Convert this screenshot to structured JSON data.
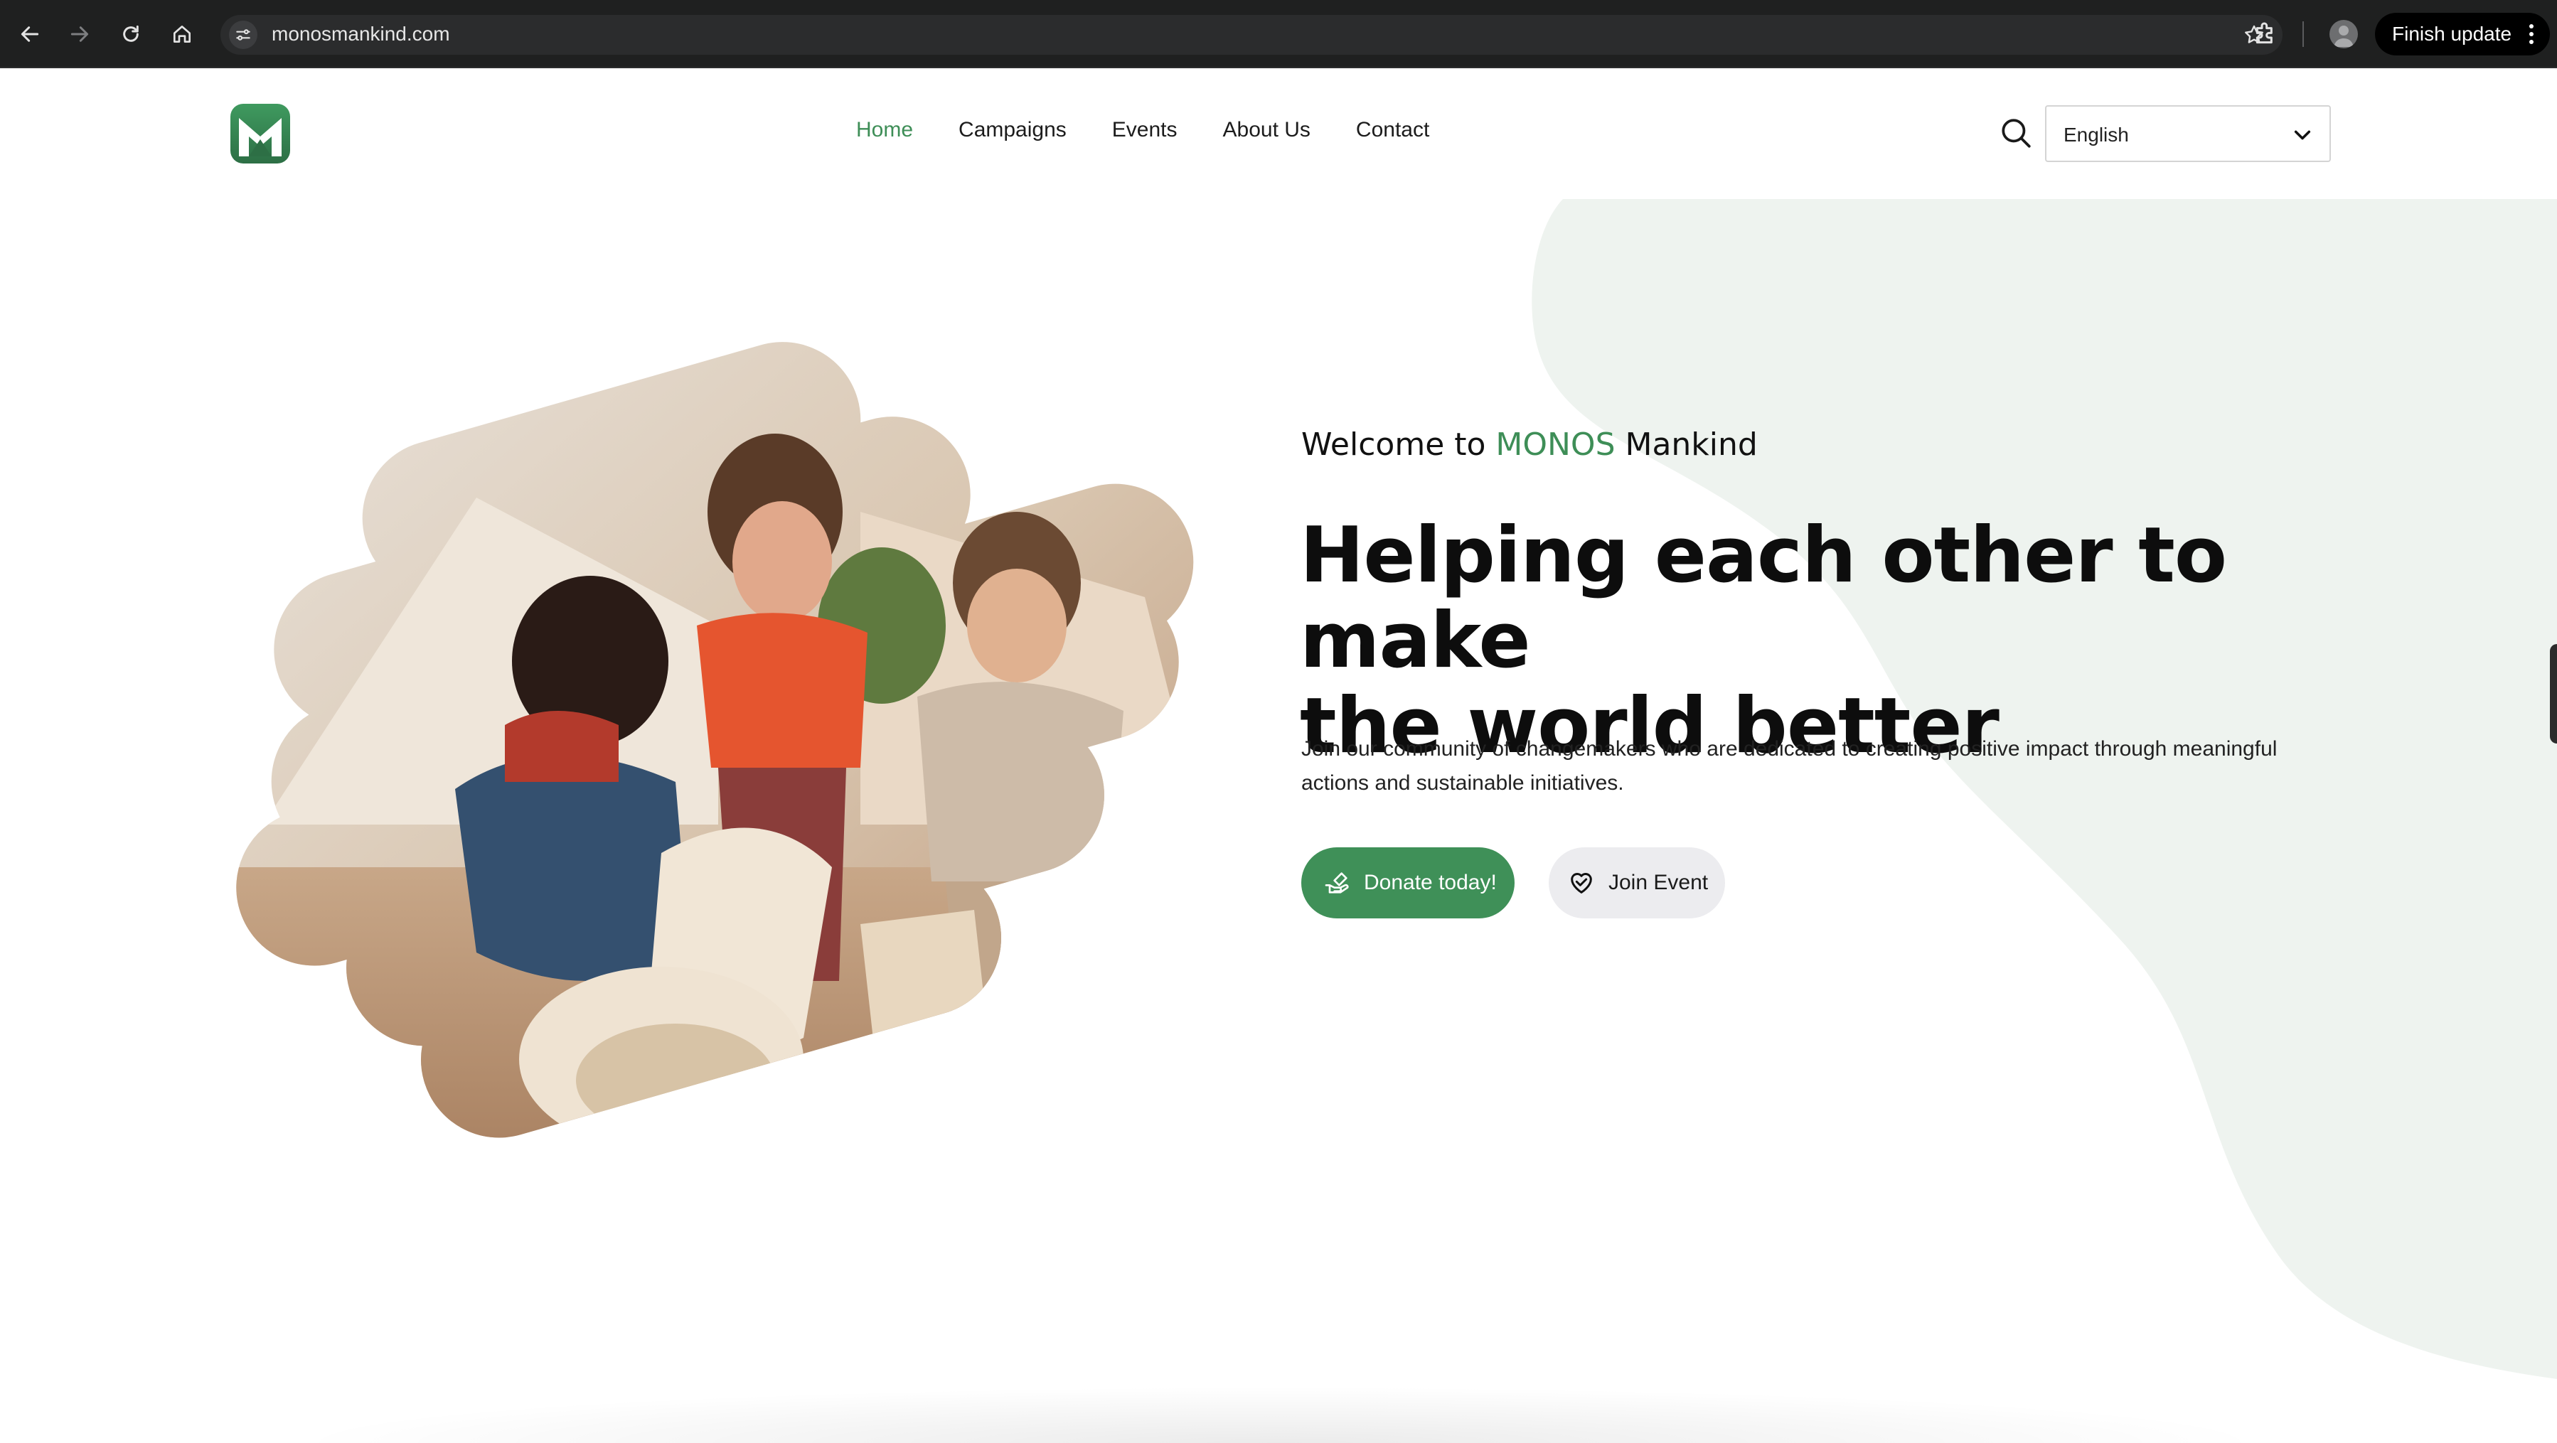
{
  "browser": {
    "url": "monosmankind.com",
    "finish_update_label": "Finish update",
    "icons": [
      "back-icon",
      "forward-icon",
      "reload-icon",
      "home-icon",
      "site-info-icon",
      "bookmark-star-icon",
      "extensions-icon",
      "profile-avatar",
      "more-vertical-icon"
    ]
  },
  "header": {
    "logo_letter": "M",
    "nav": [
      {
        "label": "Home",
        "active": true
      },
      {
        "label": "Campaigns",
        "active": false
      },
      {
        "label": "Events",
        "active": false
      },
      {
        "label": "About Us",
        "active": false
      },
      {
        "label": "Contact",
        "active": false
      }
    ],
    "language": {
      "selected": "English"
    }
  },
  "hero": {
    "welcome_prefix": "Welcome to ",
    "welcome_brand": "MONOS",
    "welcome_suffix": " Mankind",
    "headline_line1": "Helping each other to make",
    "headline_line2": "the world better",
    "lead": "Join our community of changemakers who are dedicated to creating positive impact through meaningful actions and sustainable initiatives.",
    "donate_label": "Donate today!",
    "join_label": "Join Event",
    "image_description": "children-playing-with-containers-photo"
  },
  "colors": {
    "accent": "#3e8e57",
    "hero_blob": "#eef3ef",
    "chrome_bg": "#1f2020"
  }
}
